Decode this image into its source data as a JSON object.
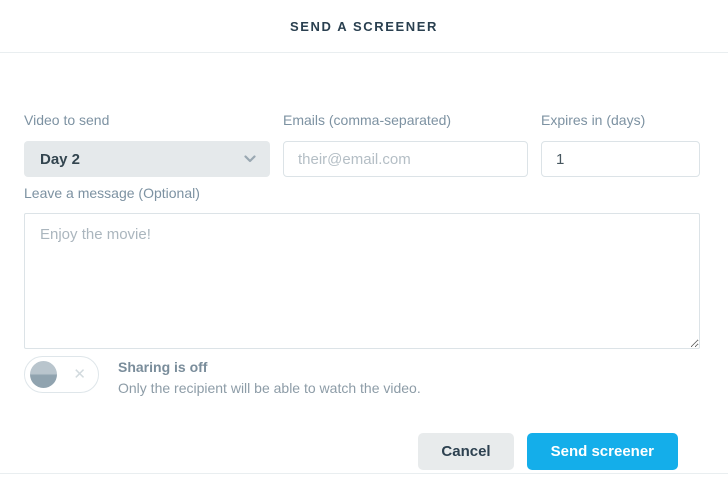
{
  "modal": {
    "title": "SEND A SCREENER"
  },
  "form": {
    "video": {
      "label": "Video to send",
      "selected": "Day 2"
    },
    "emails": {
      "label": "Emails (comma-separated)",
      "placeholder": "their@email.com"
    },
    "expires": {
      "label": "Expires in (days)",
      "value": "1"
    },
    "message": {
      "label": "Leave a message (Optional)",
      "placeholder": "Enjoy the movie!"
    }
  },
  "sharing": {
    "state": "off",
    "title": "Sharing is off",
    "description": "Only the recipient will be able to watch the video.",
    "toggle_x_glyph": "✕"
  },
  "footer": {
    "cancel": "Cancel",
    "submit": "Send screener"
  },
  "icons": {
    "dropdown": "chevron-down-icon",
    "toggle_off": "x-icon"
  },
  "colors": {
    "accent": "#14aeea",
    "title_text": "#2a4050",
    "label_text": "#7d92a2",
    "control_bg": "#e5e9eb",
    "input_border": "#dce3e7",
    "divider": "#e9eef0"
  }
}
